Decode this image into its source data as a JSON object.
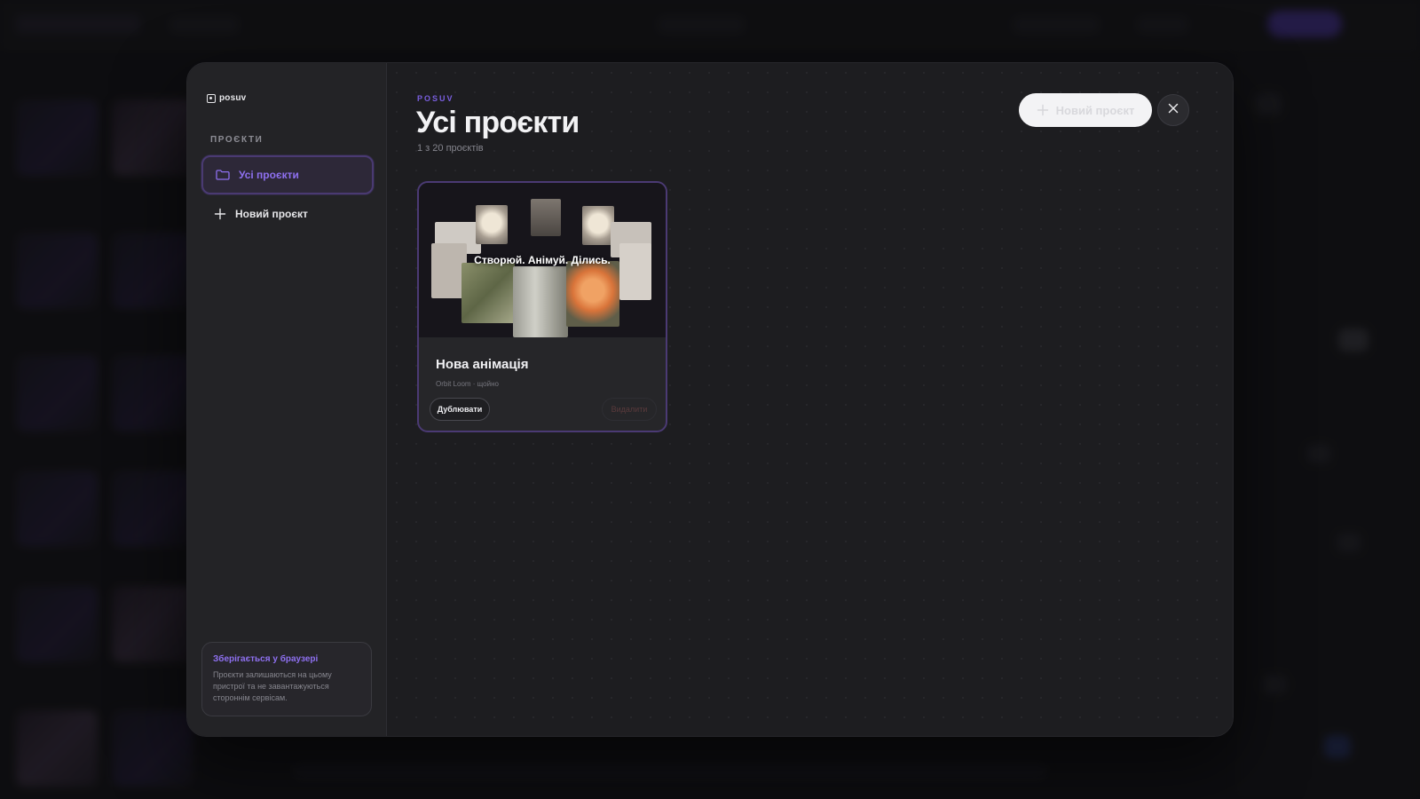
{
  "brand": {
    "name": "posuv"
  },
  "sidebar": {
    "section_label": "ПРОЄКТИ",
    "items": [
      {
        "label": "Усі проєкти",
        "icon": "folder-icon",
        "active": true
      },
      {
        "label": "Новий проєкт",
        "icon": "plus-icon",
        "active": false
      }
    ],
    "storage_note": {
      "title": "Зберігається у браузері",
      "text": "Проєкти залишаються на цьому пристрої та не завантажуються стороннім сервісам."
    }
  },
  "header": {
    "eyebrow": "POSUV",
    "title": "Усі проєкти",
    "count": "1 з 20 проєктів",
    "new_project_label": "Новий проєкт",
    "close_icon": "close-icon"
  },
  "projects": [
    {
      "thumbnail_caption": "Створюй. Анімуй. Ділись.",
      "title": "Нова анімація",
      "meta": "Orbit Loom · щойно",
      "duplicate_label": "Дублювати",
      "delete_label": "Видалити"
    }
  ],
  "colors": {
    "accent": "#8e70f0",
    "modal_bg": "#1e1e21",
    "sidebar_bg": "#232326",
    "card_border": "#4b3a74"
  }
}
